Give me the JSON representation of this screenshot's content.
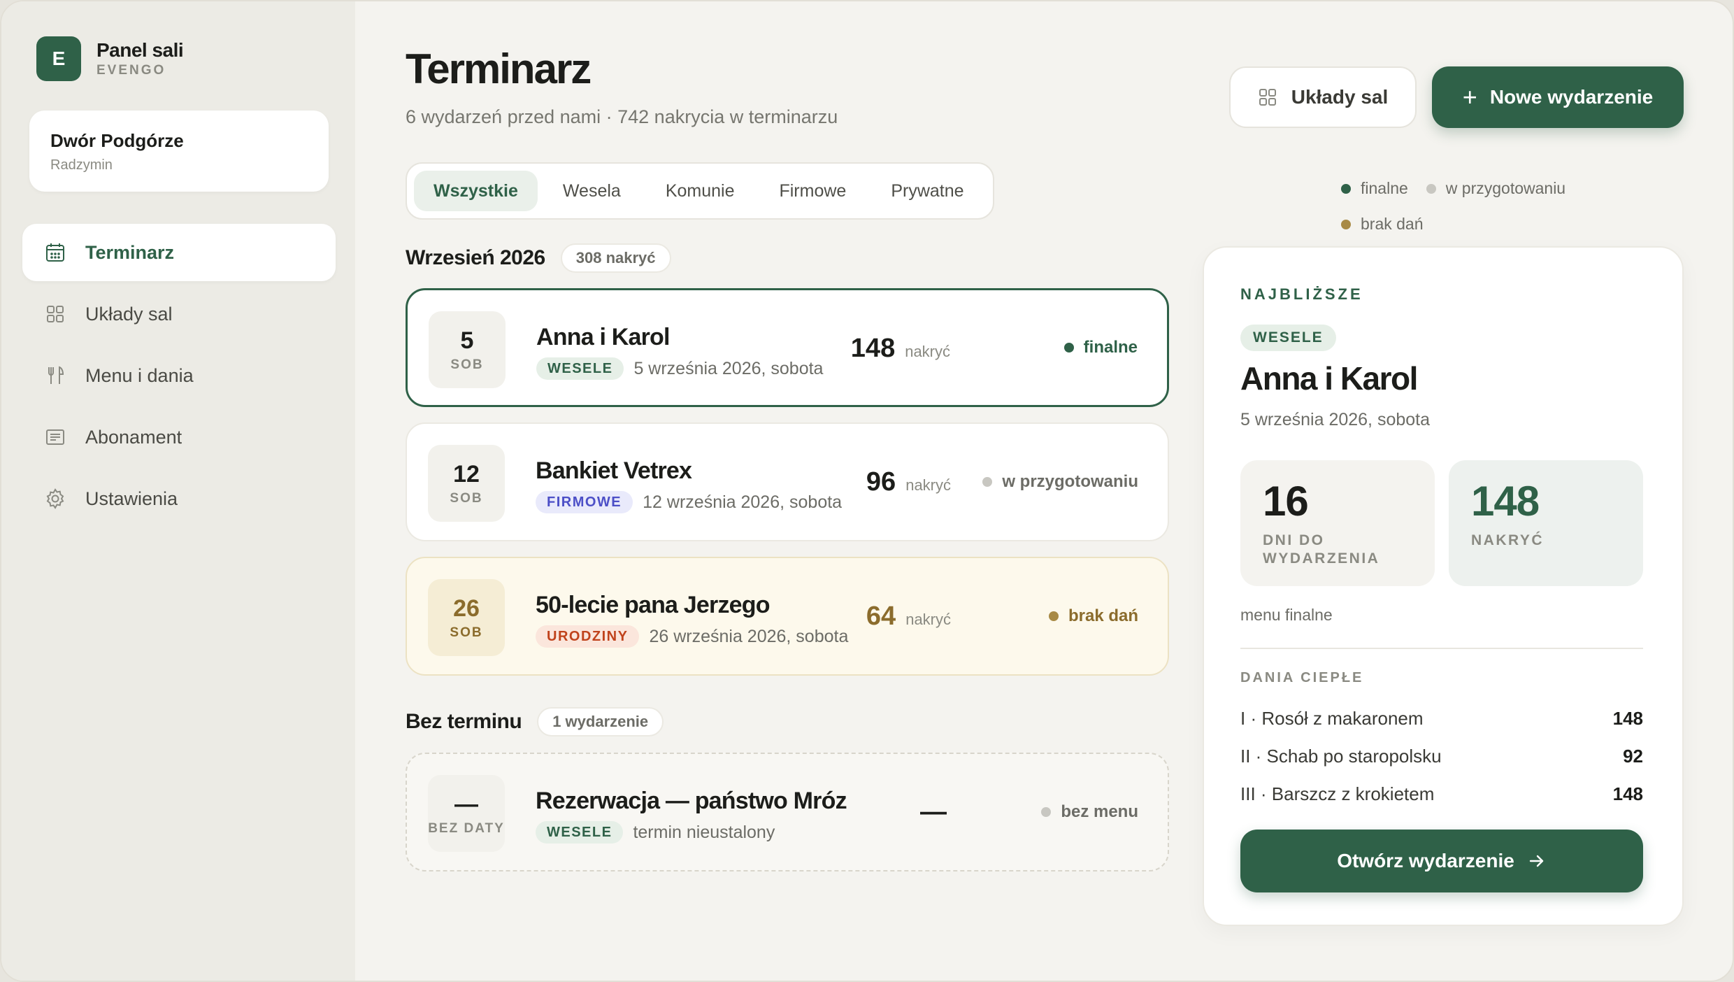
{
  "colors": {
    "accent": "#2f6148",
    "final": "#2f6148",
    "preparing": "#c8c7c1",
    "missing": "#a88a45"
  },
  "brand": {
    "logo_letter": "E",
    "name": "Panel sali",
    "sub": "EVENGO"
  },
  "venue": {
    "name": "Dwór Podgórze",
    "city": "Radzymin"
  },
  "nav": [
    {
      "label": "Terminarz",
      "icon": "calendar-icon",
      "active": true
    },
    {
      "label": "Układy sal",
      "icon": "grid-icon",
      "active": false
    },
    {
      "label": "Menu i dania",
      "icon": "fork-knife-icon",
      "active": false
    },
    {
      "label": "Abonament",
      "icon": "receipt-icon",
      "active": false
    },
    {
      "label": "Ustawienia",
      "icon": "gear-icon",
      "active": false
    }
  ],
  "header": {
    "title": "Terminarz",
    "subtitle": "6 wydarzeń przed nami · 742 nakrycia w terminarzu",
    "layouts_button": "Układy sal",
    "new_button": "Nowe wydarzenie"
  },
  "tabs": [
    "Wszystkie",
    "Wesela",
    "Komunie",
    "Firmowe",
    "Prywatne"
  ],
  "legend": {
    "final": "finalne",
    "preparing": "w przygotowaniu",
    "missing": "brak dań"
  },
  "sections": {
    "september": {
      "title": "Wrzesień 2026",
      "count": "308 nakryć"
    },
    "undated": {
      "title": "Bez terminu",
      "count": "1 wydarzenie"
    }
  },
  "events": [
    {
      "day": "5",
      "weekday": "SOB",
      "name": "Anna i Karol",
      "type": "WESELE",
      "date": "5 września 2026, sobota",
      "covers": "148",
      "covers_label": "nakryć",
      "status": "finalne"
    },
    {
      "day": "12",
      "weekday": "SOB",
      "name": "Bankiet Vetrex",
      "type": "FIRMOWE",
      "date": "12 września 2026, sobota",
      "covers": "96",
      "covers_label": "nakryć",
      "status": "w przygotowaniu"
    },
    {
      "day": "26",
      "weekday": "SOB",
      "name": "50-lecie pana Jerzego",
      "type": "URODZINY",
      "date": "26 września 2026, sobota",
      "covers": "64",
      "covers_label": "nakryć",
      "status": "brak dań"
    },
    {
      "day": "—",
      "weekday": "BEZ DATY",
      "name": "Rezerwacja — państwo Mróz",
      "type": "WESELE",
      "date": "termin nieustalony",
      "covers": "—",
      "status": "bez menu"
    }
  ],
  "detail": {
    "eyebrow": "NAJBLIŻSZE",
    "type": "WESELE",
    "name": "Anna i Karol",
    "date": "5 września 2026, sobota",
    "days_value": "16",
    "days_label_1": "DNI DO",
    "days_label_2": "WYDARZENIA",
    "covers_value": "148",
    "covers_label": "NAKRYĆ",
    "menu_state": "menu finalne",
    "dishes_title": "DANIA CIEPŁE",
    "dishes": [
      {
        "name": "I · Rosół z makaronem",
        "qty": "148"
      },
      {
        "name": "II · Schab po staropolsku",
        "qty": "92"
      },
      {
        "name": "III · Barszcz z krokietem",
        "qty": "148"
      }
    ],
    "open_button": "Otwórz wydarzenie"
  }
}
